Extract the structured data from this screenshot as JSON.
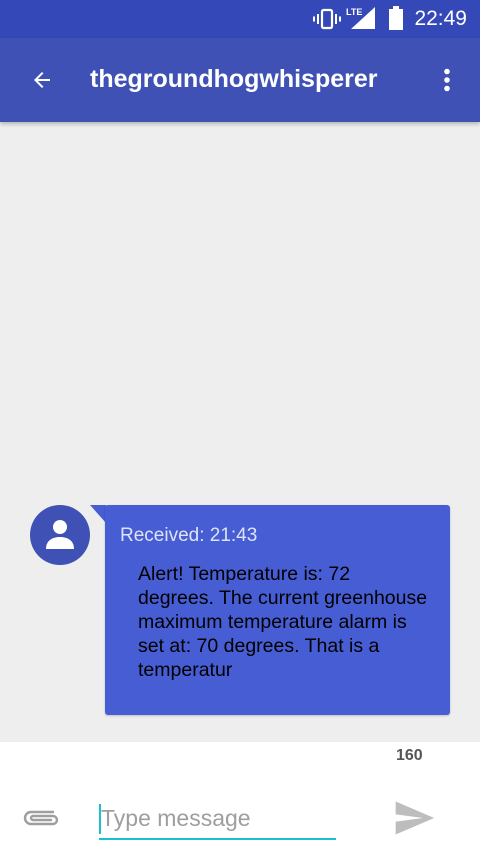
{
  "status_bar": {
    "time": "22:49",
    "network_label": "LTE",
    "icons": [
      "vibrate-icon",
      "lte-signal-icon",
      "battery-icon"
    ]
  },
  "app_bar": {
    "title": "thegroundhogwhisperer",
    "back_icon": "arrow-back-icon",
    "menu_icon": "more-vert-icon"
  },
  "conversation": {
    "messages": [
      {
        "direction": "received",
        "timestamp": "Received: 21:43",
        "text": "Alert! Temperature is: 72 degrees. The current greenhouse maximum temperature alarm is set at: 70 degrees. That is a temperatur",
        "avatar_icon": "person-icon"
      }
    ]
  },
  "compose": {
    "char_count": "160",
    "placeholder": "Type message",
    "value": "",
    "attach_icon": "paperclip-icon",
    "send_icon": "send-icon"
  },
  "colors": {
    "status_bar": "#3449b7",
    "app_bar": "#3f51b5",
    "bubble": "#475dd4",
    "accent": "#1bbfd0",
    "background": "#eeeeee"
  }
}
